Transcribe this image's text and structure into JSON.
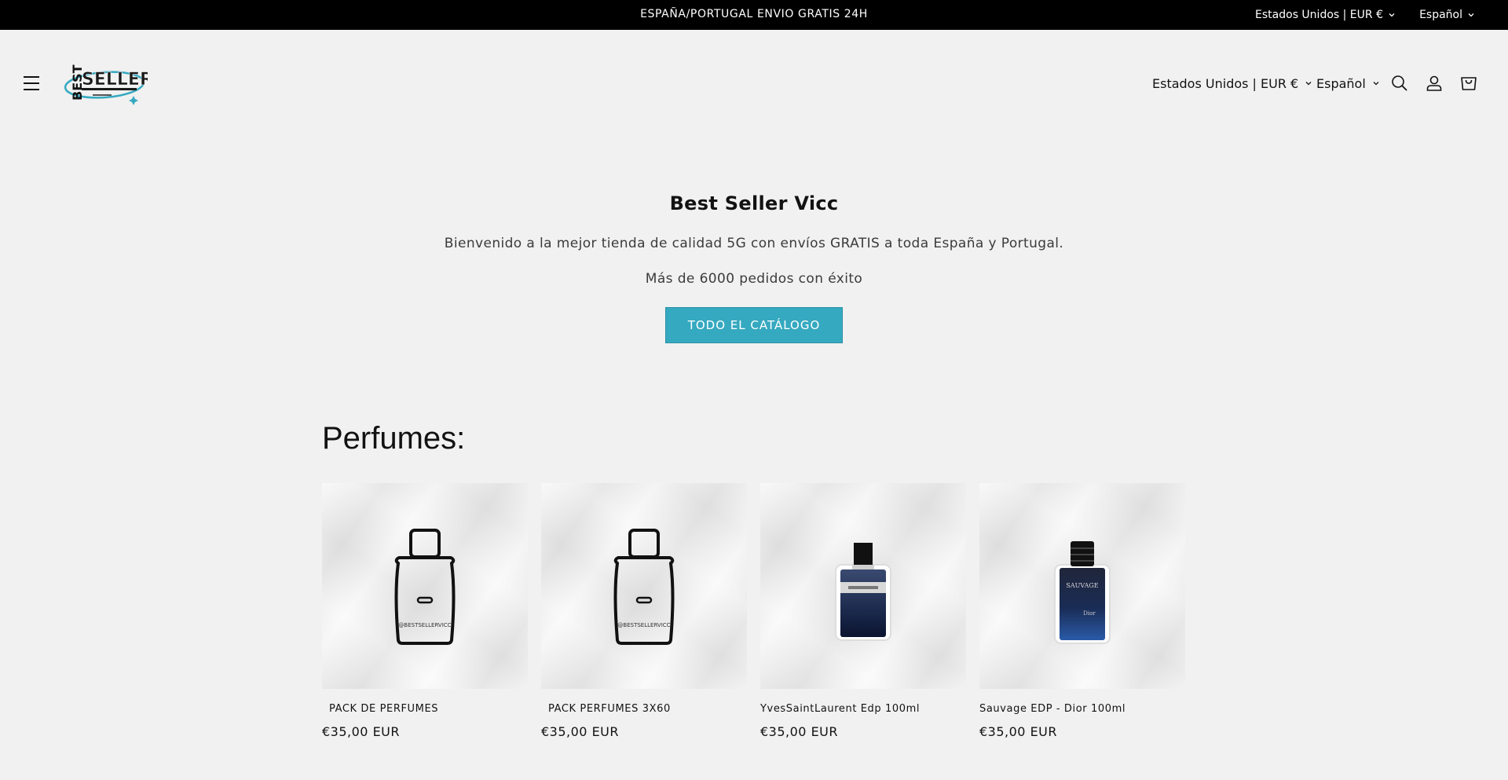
{
  "announcement": {
    "text": "ESPAÑA/PORTUGAL ENVIO GRATIS 24H",
    "country": "Estados Unidos | EUR €",
    "language": "Español"
  },
  "header": {
    "logo_text": "BEST SELLER",
    "country": "Estados Unidos | EUR €",
    "language": "Español",
    "icons": [
      "menu-icon",
      "search-icon",
      "account-icon",
      "cart-icon"
    ]
  },
  "hero": {
    "title": "Best Seller Vicc",
    "text1": "Bienvenido a la mejor tienda de calidad 5G con envíos GRATIS a toda España y Portugal.",
    "text2": "Más de 6000 pedidos con éxito",
    "button": "TODO EL CATÁLOGO"
  },
  "collection": {
    "title": "Perfumes:",
    "products": [
      {
        "title": "PACK DE PERFUMES",
        "price": "€35,00 EUR",
        "watermark": "@BESTSELLERVICC"
      },
      {
        "title": "PACK PERFUMES 3X60",
        "price": "€35,00 EUR",
        "watermark": "@BESTSELLERVICC"
      },
      {
        "title": "YvesSaintLaurent Edp 100ml",
        "price": "€35,00 EUR"
      },
      {
        "title": "Sauvage EDP - Dior 100ml",
        "price": "€35,00 EUR",
        "bottle_label": "SAUVAGE",
        "brand": "Dior"
      }
    ]
  },
  "colors": {
    "background": "#f1f1f1",
    "announcement_bg": "#000000",
    "button_bg": "#35a9c0",
    "text": "#121212"
  }
}
